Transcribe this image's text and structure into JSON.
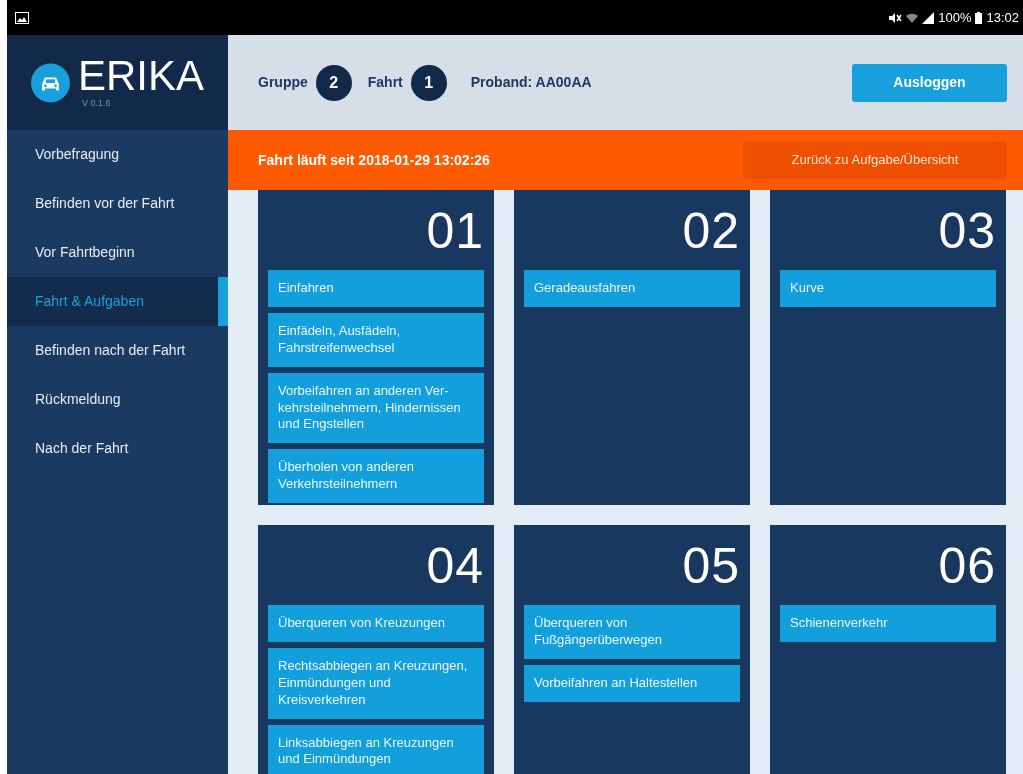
{
  "status_bar": {
    "battery": "100%",
    "time": "13:02"
  },
  "app": {
    "name": "ERIKA",
    "version": "V 0.1.6"
  },
  "sidebar": {
    "items": [
      {
        "label": "Vorbefragung",
        "selected": false
      },
      {
        "label": "Befinden vor der Fahrt",
        "selected": false
      },
      {
        "label": "Vor Fahrtbeginn",
        "selected": false
      },
      {
        "label": "Fahrt & Aufgaben",
        "selected": true
      },
      {
        "label": "Befinden nach der Fahrt",
        "selected": false
      },
      {
        "label": "Rückmeldung",
        "selected": false
      },
      {
        "label": "Nach der Fahrt",
        "selected": false
      }
    ]
  },
  "header": {
    "group_label": "Gruppe",
    "group": "2",
    "drive_label": "Fahrt",
    "drive": "1",
    "subject": "Proband: AA00AA",
    "logout": "Ausloggen"
  },
  "banner": {
    "text": "Fahrt läuft seit 2018-01-29 13:02:26",
    "button": "Zurück zu Aufgabe/Übersicht"
  },
  "sections": [
    {
      "number": "01",
      "tasks": [
        "Einfahren",
        "Einfädeln, Ausfädeln, Fahrstreifenwechsel",
        "Vorbeifahren an anderen Ver-kehrsteilnehmern, Hindernissen und Engstellen",
        "Überholen von anderen Verkehrsteilnehmern"
      ]
    },
    {
      "number": "02",
      "tasks": [
        "Geradeausfahren"
      ]
    },
    {
      "number": "03",
      "tasks": [
        "Kurve"
      ]
    },
    {
      "number": "04",
      "tasks": [
        "Überqueren von Kreuzungen",
        "Rechtsabbiegen an Kreuzungen, Einmündungen und Kreisverkehren",
        "Linksabbiegen an Kreuzungen und Einmündungen"
      ]
    },
    {
      "number": "05",
      "tasks": [
        "Überqueren von Fußgängerüberwegen",
        "Vorbeifahren an Haltestellen"
      ]
    },
    {
      "number": "06",
      "tasks": [
        "Schienenverkehr"
      ]
    }
  ]
}
